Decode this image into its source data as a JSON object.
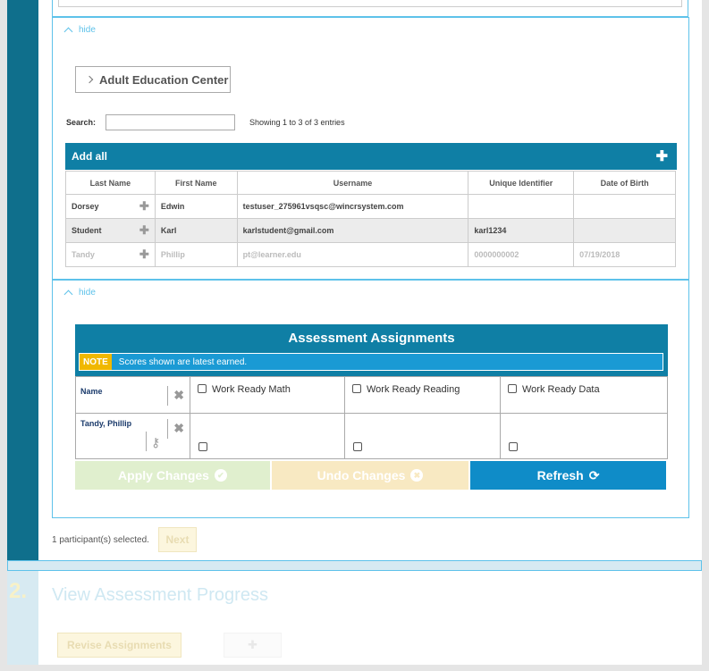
{
  "panel1": {
    "hide_label": "hide",
    "org_button": "Adult Education Center",
    "search_label": "Search:",
    "search_value": "",
    "showing_text": "Showing 1 to 3 of 3 entries",
    "add_all_label": "Add all",
    "columns": [
      "Last Name",
      "First Name",
      "Username",
      "Unique Identifier",
      "Date of Birth"
    ],
    "rows": [
      {
        "last": "Dorsey",
        "first": "Edwin",
        "username": "testuser_275961vsqsc@wincrsystem.com",
        "uid": "",
        "dob": ""
      },
      {
        "last": "Student",
        "first": "Karl",
        "username": "karlstudent@gmail.com",
        "uid": "karl1234",
        "dob": ""
      },
      {
        "last": "Tandy",
        "first": "Phillip",
        "username": "pt@learner.edu",
        "uid": "0000000002",
        "dob": "07/19/2018"
      }
    ]
  },
  "panel2": {
    "hide_label": "hide",
    "title": "Assessment Assignments",
    "note_tag": "NOTE",
    "note_text": "Scores shown are latest earned.",
    "name_header": "Name",
    "assessments": [
      "Work Ready Math",
      "Work Ready Reading",
      "Work Ready Data"
    ],
    "student": "Tandy, Phillip",
    "apply_label": "Apply Changes",
    "undo_label": "Undo Changes",
    "refresh_label": "Refresh"
  },
  "footer": {
    "selected_text": "1 participant(s) selected.",
    "next_label": "Next"
  },
  "step2": {
    "number": "2.",
    "title": "View Assessment Progress",
    "revise_label": "Revise Assignments"
  }
}
